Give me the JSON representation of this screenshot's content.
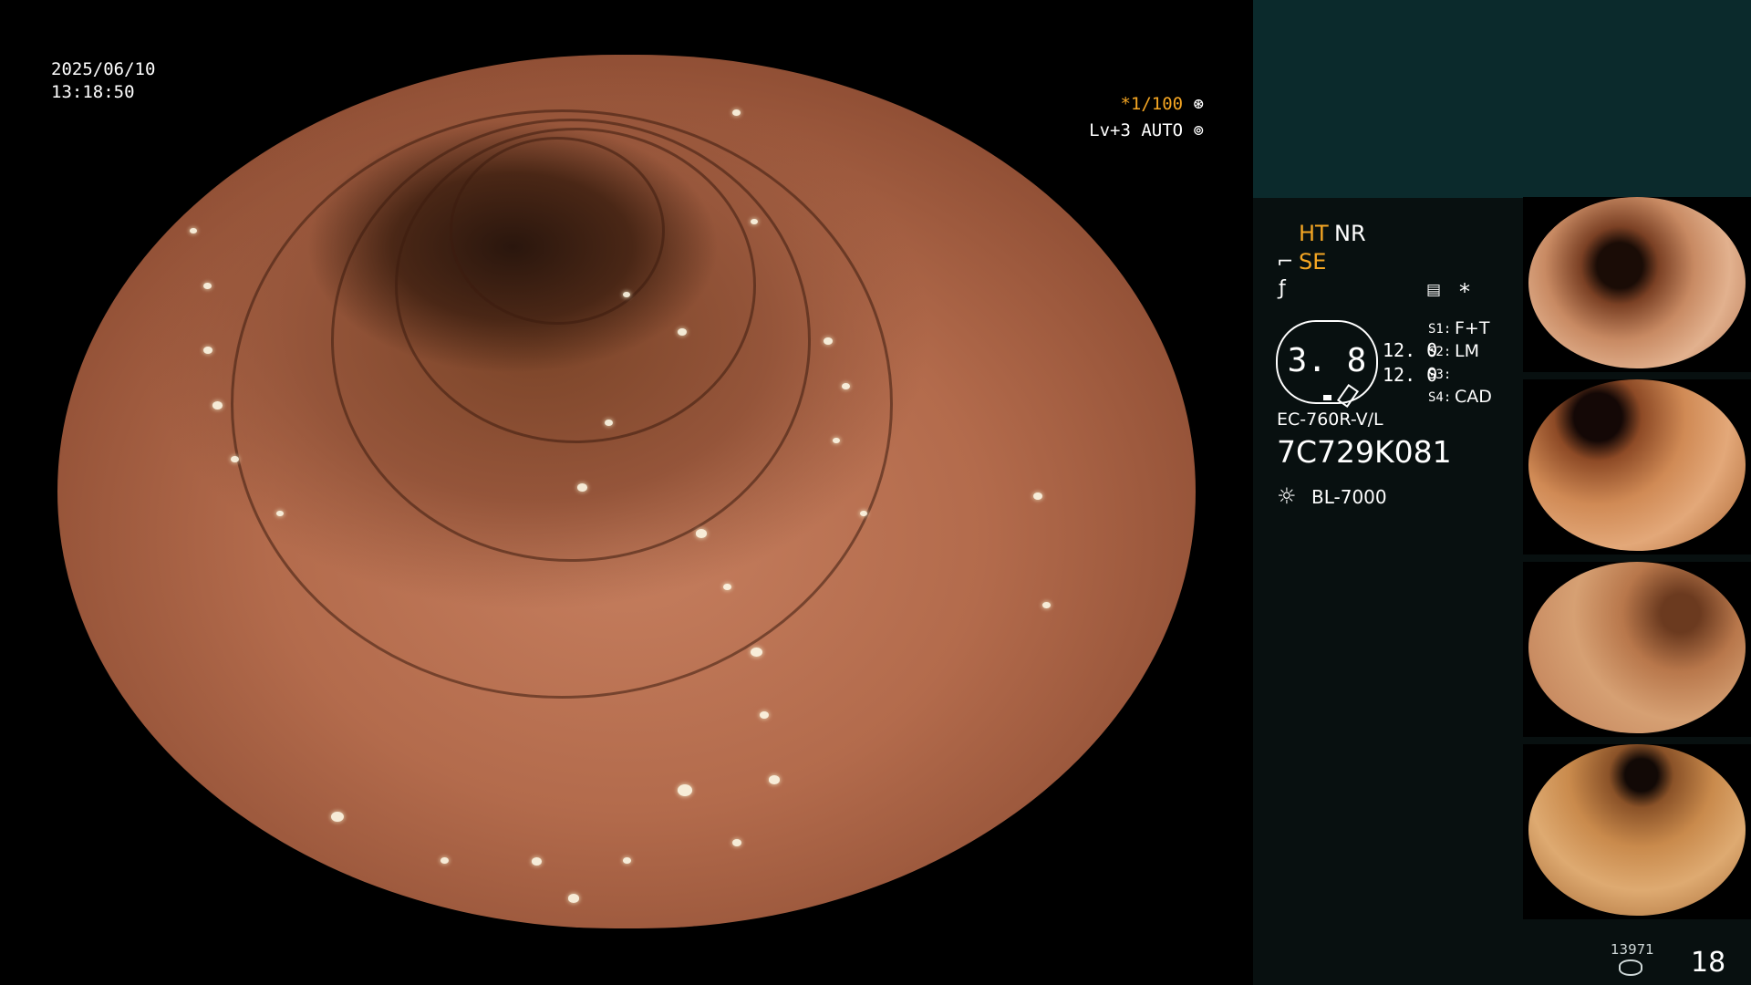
{
  "overlay": {
    "date": "2025/06/10",
    "time": "13:18:50",
    "shutter": "*1/100",
    "shutter_icon": "aperture-icon",
    "level": "Lv+3 AUTO",
    "level_icon": "auto-iris-icon"
  },
  "panel": {
    "mode_ht": "HT",
    "mode_nr": "NR",
    "mode_se": "SE",
    "ratio_value": "3. 8",
    "val_top": "12. 0",
    "val_bottom": "12. 0",
    "s1_label": "S1:",
    "s1_value": "F+T",
    "s2_label": "S2:",
    "s2_value": "LM",
    "s3_label": "S3:",
    "s3_value": "",
    "s4_label": "S4:",
    "s4_value": "CAD",
    "asterisk": "*",
    "scope_model": "EC-760R-V/L",
    "serial": "7C729K081",
    "light_source": "BL-7000",
    "storage_count": "13971",
    "image_count": "18"
  },
  "colors": {
    "accent_orange": "#f5a623",
    "panel_bg": "#081010",
    "panel_header_bg": "#0b2a2c"
  }
}
